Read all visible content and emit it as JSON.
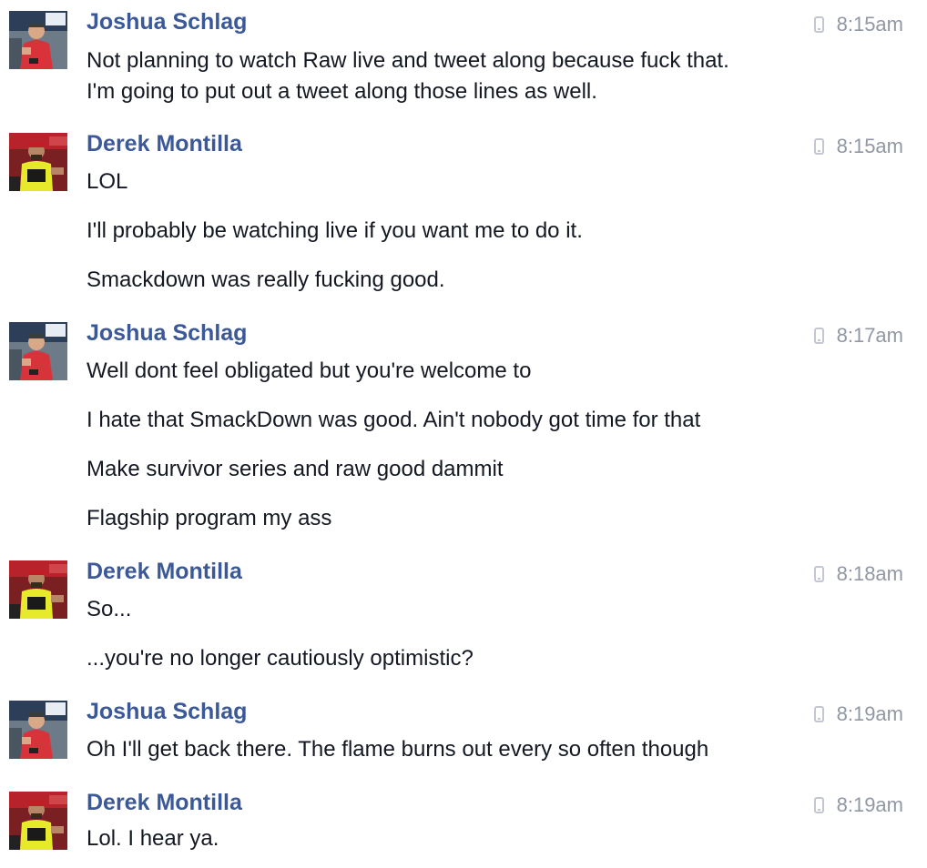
{
  "groups": [
    {
      "author": "Joshua Schlag",
      "avatar": "joshua-avatar",
      "time": "8:15am",
      "messages": [
        "Not planning to watch Raw live and tweet along because fuck that.",
        "I'm going to put out a tweet along those lines as well."
      ]
    },
    {
      "author": "Derek Montilla",
      "avatar": "derek-avatar",
      "time": "8:15am",
      "messages": [
        "LOL",
        "I'll probably be watching live if you want me to do it.",
        "Smackdown was really fucking good."
      ]
    },
    {
      "author": "Joshua Schlag",
      "avatar": "joshua-avatar",
      "time": "8:17am",
      "messages": [
        "Well dont feel obligated but you're welcome to",
        "I hate that SmackDown was good. Ain't nobody got time for that",
        "Make survivor series and raw good dammit",
        "Flagship program my ass"
      ]
    },
    {
      "author": "Derek Montilla",
      "avatar": "derek-avatar",
      "time": "8:18am",
      "messages": [
        "So...",
        "...you're no longer cautiously optimistic?"
      ]
    },
    {
      "author": "Joshua Schlag",
      "avatar": "joshua-avatar",
      "time": "8:19am",
      "messages": [
        "Oh I'll get back there. The flame burns out every so often though"
      ]
    },
    {
      "author": "Derek Montilla",
      "avatar": "derek-avatar",
      "time": "8:19am",
      "messages": [
        "Lol. I hear ya."
      ]
    }
  ],
  "icons": {
    "timestamp_icon": "mobile-phone-icon"
  },
  "colors": {
    "author": "#3b5998",
    "timestamp": "#9197a3",
    "text": "#141823"
  }
}
